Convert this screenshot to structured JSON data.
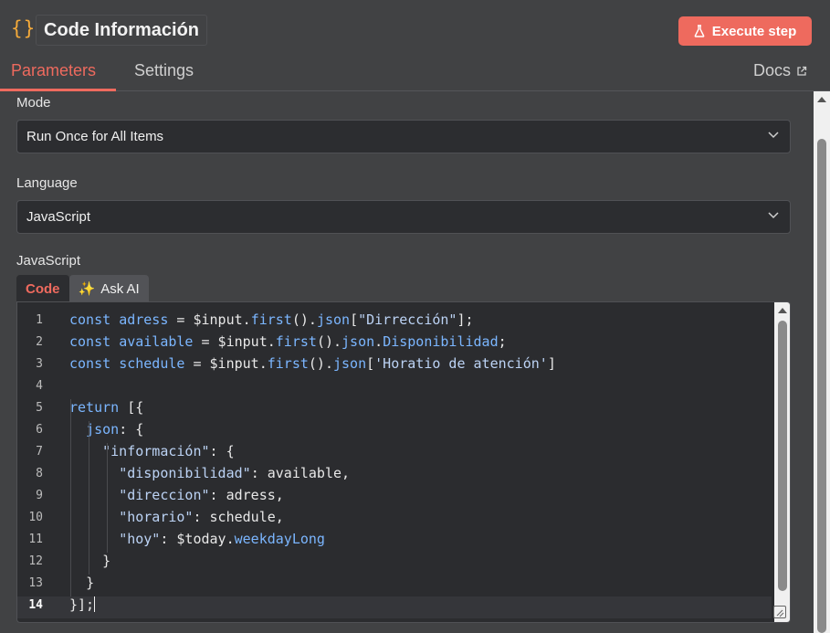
{
  "header": {
    "icon": "code-braces-icon",
    "icon_glyph": "{}",
    "title": "Code Información",
    "execute_label": "Execute step",
    "execute_icon": "flask-icon",
    "accent_color": "#ee6a5e"
  },
  "tabs": [
    {
      "label": "Parameters",
      "active": true
    },
    {
      "label": "Settings",
      "active": false
    }
  ],
  "docs": {
    "label": "Docs",
    "icon": "external-link-icon"
  },
  "fields": {
    "mode": {
      "label": "Mode",
      "value": "Run Once for All Items"
    },
    "language": {
      "label": "Language",
      "value": "JavaScript"
    }
  },
  "editor": {
    "label": "JavaScript",
    "tabs": {
      "code": "Code",
      "ask_ai": "Ask AI",
      "ask_ai_icon": "sparkles-icon",
      "ask_ai_glyph": "✨"
    },
    "active_line": 14,
    "lines": [
      {
        "n": "1",
        "indent": "",
        "tokens": [
          [
            "kw",
            "const"
          ],
          [
            "txt",
            " "
          ],
          [
            "var",
            "adress"
          ],
          [
            "txt",
            " = $input."
          ],
          [
            "var",
            "first"
          ],
          [
            "txt",
            "()."
          ],
          [
            "var",
            "json"
          ],
          [
            "txt",
            "["
          ],
          [
            "str",
            "\"Dirrección\""
          ],
          [
            "txt",
            "];"
          ]
        ]
      },
      {
        "n": "2",
        "indent": "",
        "tokens": [
          [
            "kw",
            "const"
          ],
          [
            "txt",
            " "
          ],
          [
            "var",
            "available"
          ],
          [
            "txt",
            " = $input."
          ],
          [
            "var",
            "first"
          ],
          [
            "txt",
            "()."
          ],
          [
            "var",
            "json"
          ],
          [
            "txt",
            "."
          ],
          [
            "var",
            "Disponibilidad"
          ],
          [
            "txt",
            ";"
          ]
        ]
      },
      {
        "n": "3",
        "indent": "",
        "tokens": [
          [
            "kw",
            "const"
          ],
          [
            "txt",
            " "
          ],
          [
            "var",
            "schedule"
          ],
          [
            "txt",
            " = $input."
          ],
          [
            "var",
            "first"
          ],
          [
            "txt",
            "()."
          ],
          [
            "var",
            "json"
          ],
          [
            "txt",
            "["
          ],
          [
            "str",
            "'Horatio de atención'"
          ],
          [
            "txt",
            "]"
          ]
        ]
      },
      {
        "n": "4",
        "indent": "",
        "tokens": []
      },
      {
        "n": "5",
        "indent": "",
        "tokens": [
          [
            "kw",
            "return"
          ],
          [
            "txt",
            " [{"
          ]
        ]
      },
      {
        "n": "6",
        "indent": "  ",
        "tokens": [
          [
            "var",
            "json"
          ],
          [
            "txt",
            ": {"
          ]
        ]
      },
      {
        "n": "7",
        "indent": "    ",
        "tokens": [
          [
            "str",
            "\"información\""
          ],
          [
            "txt",
            ": {"
          ]
        ]
      },
      {
        "n": "8",
        "indent": "      ",
        "tokens": [
          [
            "str",
            "\"disponibilidad\""
          ],
          [
            "txt",
            ": available,"
          ]
        ]
      },
      {
        "n": "9",
        "indent": "      ",
        "tokens": [
          [
            "str",
            "\"direccion\""
          ],
          [
            "txt",
            ": adress,"
          ]
        ]
      },
      {
        "n": "10",
        "indent": "      ",
        "tokens": [
          [
            "str",
            "\"horario\""
          ],
          [
            "txt",
            ": schedule,"
          ]
        ]
      },
      {
        "n": "11",
        "indent": "      ",
        "tokens": [
          [
            "str",
            "\"hoy\""
          ],
          [
            "txt",
            ": $today."
          ],
          [
            "var",
            "weekdayLong"
          ]
        ]
      },
      {
        "n": "12",
        "indent": "    ",
        "tokens": [
          [
            "txt",
            "}"
          ]
        ]
      },
      {
        "n": "13",
        "indent": "  ",
        "tokens": [
          [
            "txt",
            "}"
          ]
        ]
      },
      {
        "n": "14",
        "indent": "",
        "tokens": [
          [
            "txt",
            "}];"
          ]
        ]
      }
    ]
  }
}
